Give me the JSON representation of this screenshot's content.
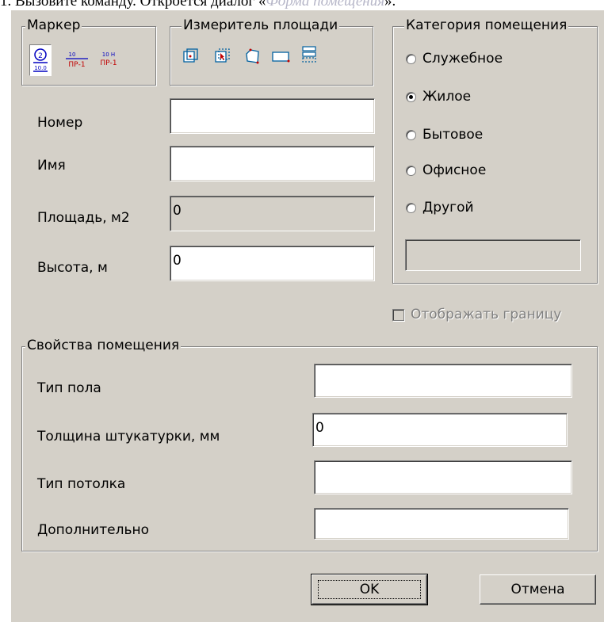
{
  "caption": {
    "before": "1. Вызовите команду. Откроется диалог «",
    "italic": "Форма помещения",
    "after": "»."
  },
  "marker_group": {
    "legend": "Маркер",
    "icons": [
      "room-marker-icon",
      "room-marker-table-icon",
      "room-marker-table-alt-icon"
    ]
  },
  "area_group": {
    "legend": "Измеритель площади",
    "icons": [
      "area-point-icon",
      "area-select-icon",
      "area-polyline-icon",
      "area-rectangle-icon",
      "area-table-icon"
    ]
  },
  "category_group": {
    "legend": "Категория помещения",
    "options": [
      {
        "label": "Служебное",
        "checked": false
      },
      {
        "label": "Жилое",
        "checked": true
      },
      {
        "label": "Бытовое",
        "checked": false
      },
      {
        "label": "Офисное",
        "checked": false
      },
      {
        "label": "Другой",
        "checked": false
      }
    ],
    "other_value": ""
  },
  "fields": {
    "number": {
      "label": "Номер",
      "value": ""
    },
    "name": {
      "label": "Имя",
      "value": ""
    },
    "area": {
      "label": "Площадь, м2",
      "value": "0"
    },
    "height": {
      "label": "Высота, м",
      "value": "0"
    }
  },
  "show_border": {
    "label": "Отображать границу",
    "checked": false,
    "enabled": false
  },
  "properties_group": {
    "legend": "Свойства помещения",
    "floor_type": {
      "label": "Тип пола",
      "value": ""
    },
    "plaster_thickness": {
      "label": "Толщина штукатурки, мм",
      "value": "0"
    },
    "ceiling_type": {
      "label": "Тип потолка",
      "value": ""
    },
    "additional": {
      "label": "Дополнительно",
      "value": ""
    }
  },
  "buttons": {
    "ok": "OK",
    "cancel": "Отмена"
  }
}
